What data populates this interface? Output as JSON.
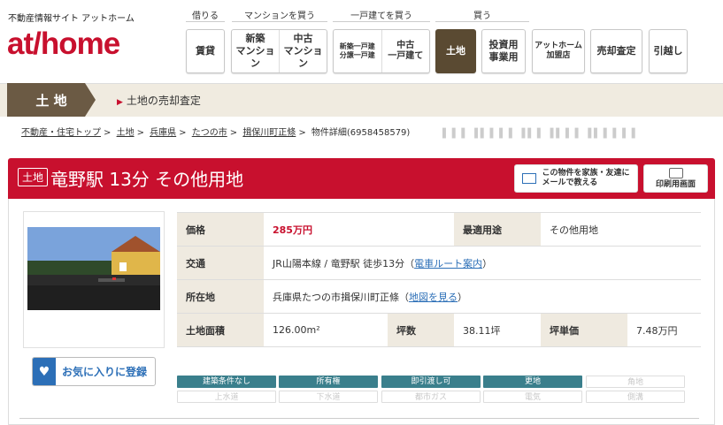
{
  "header": {
    "tagline": "不動産情報サイト アットホーム",
    "logo": "athome",
    "groups": {
      "rent": "借りる",
      "mansion": "マンションを買う",
      "house": "一戸建てを買う",
      "buy": "買う"
    },
    "nav": {
      "chintai": "賃貸",
      "new_mansion": "新築\nマンション",
      "used_mansion": "中古\nマンション",
      "new_house": "新築一戸建\n分譲一戸建",
      "used_house": "中古\n一戸建て",
      "land": "土地",
      "investment": "投資用\n事業用",
      "franchise": "アットホーム\n加盟店",
      "sell": "売却査定",
      "moving": "引越し"
    }
  },
  "category": {
    "label": "土 地",
    "sub": "土地の売却査定"
  },
  "breadcrumb": {
    "items": [
      "不動産・住宅トップ",
      "土地",
      "兵庫県",
      "たつの市",
      "揖保川町正條"
    ],
    "current": "物件詳細(6958458579)"
  },
  "title": {
    "badge": "土地",
    "text": "竜野駅 13分 その他用地",
    "share_btn": "この物件を家族・友達に\nメールで教える",
    "print_btn": "印刷用画面"
  },
  "favorite": {
    "label": "お気に入りに登録"
  },
  "spec": {
    "price_label": "価格",
    "price": "285万円",
    "use_label": "最適用途",
    "use": "その他用地",
    "access_label": "交通",
    "access": "JR山陽本線 / 竜野駅 徒歩13分",
    "route_link": "電車ルート案内",
    "address_label": "所在地",
    "address": "兵庫県たつの市揖保川町正條",
    "map_link": "地図を見る",
    "area_label": "土地面積",
    "area": "126.00m²",
    "tsubo_label": "坪数",
    "tsubo": "38.11坪",
    "tsubo_price_label": "坪単価",
    "tsubo_price": "7.48万円"
  },
  "tags": {
    "row1": [
      {
        "t": "建築条件なし",
        "on": true
      },
      {
        "t": "所有権",
        "on": true
      },
      {
        "t": "即引渡し可",
        "on": true
      },
      {
        "t": "更地",
        "on": true
      },
      {
        "t": "角地",
        "on": false
      }
    ],
    "row2": [
      {
        "t": "上水道",
        "on": false
      },
      {
        "t": "下水道",
        "on": false
      },
      {
        "t": "都市ガス",
        "on": false
      },
      {
        "t": "電気",
        "on": false
      },
      {
        "t": "側溝",
        "on": false
      }
    ]
  },
  "colors": {
    "brand": "#c8102e",
    "category": "#6b5a44",
    "tag": "#3a7f8c",
    "link": "#2c6fb7"
  }
}
